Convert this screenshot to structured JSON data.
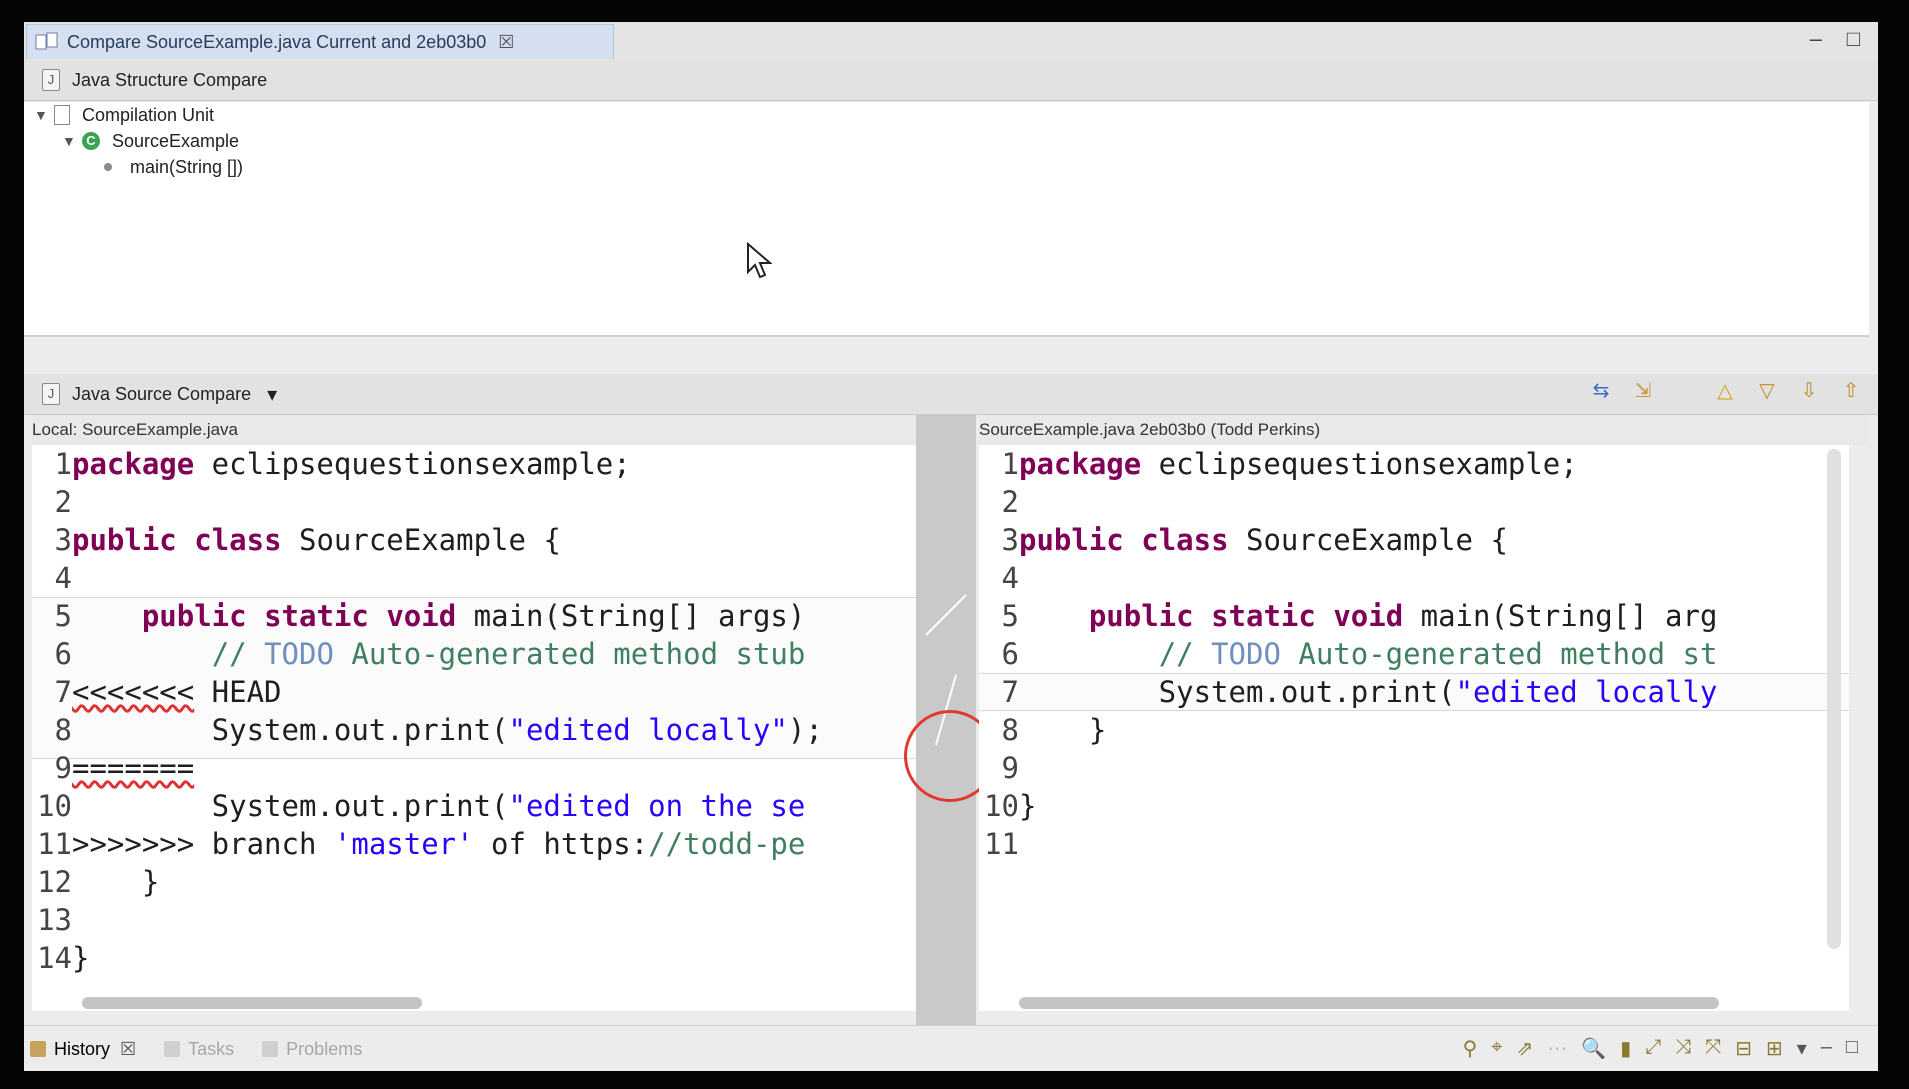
{
  "editor_tab": {
    "title": "Compare SourceExample.java Current and 2eb03b0",
    "close": "☒"
  },
  "window_controls": {
    "minimize": "–",
    "maximize": "□"
  },
  "structure_compare": {
    "title": "Java Structure Compare",
    "tree": [
      {
        "label": "Compilation Unit",
        "icon": "compilation-unit-icon"
      },
      {
        "label": "SourceExample",
        "icon": "class-icon"
      },
      {
        "label": "main(String [])",
        "icon": "method-icon"
      }
    ]
  },
  "source_compare": {
    "title": "Java Source Compare",
    "dropdown": "▾",
    "toolbar_icons": [
      "copy-all-icon",
      "copy-icon",
      "next-diff-icon",
      "prev-diff-icon",
      "next-change-icon",
      "prev-change-icon"
    ],
    "left_label": "Local: SourceExample.java",
    "right_label": "SourceExample.java 2eb03b0 (Todd Perkins)",
    "left_lines": [
      {
        "n": "1",
        "text": "package eclipsequestionsexample;"
      },
      {
        "n": "2",
        "text": ""
      },
      {
        "n": "3",
        "text": "public class SourceExample {"
      },
      {
        "n": "4",
        "text": ""
      },
      {
        "n": "5",
        "text": "    public static void main(String[] args)"
      },
      {
        "n": "6",
        "text": "        // TODO Auto-generated method stub"
      },
      {
        "n": "7",
        "text": "<<<<<<< HEAD"
      },
      {
        "n": "8",
        "text": "        System.out.print(\"edited locally\");"
      },
      {
        "n": "9",
        "text": "======="
      },
      {
        "n": "10",
        "text": "        System.out.print(\"edited on the se"
      },
      {
        "n": "11",
        "text": ">>>>>>> branch 'master' of https://todd-pe"
      },
      {
        "n": "12",
        "text": "    }"
      },
      {
        "n": "13",
        "text": ""
      },
      {
        "n": "14",
        "text": "}"
      }
    ],
    "right_lines": [
      {
        "n": "1",
        "text": "package eclipsequestionsexample;"
      },
      {
        "n": "2",
        "text": ""
      },
      {
        "n": "3",
        "text": "public class SourceExample {"
      },
      {
        "n": "4",
        "text": ""
      },
      {
        "n": "5",
        "text": "    public static void main(String[] arg"
      },
      {
        "n": "6",
        "text": "        // TODO Auto-generated method st"
      },
      {
        "n": "7",
        "text": "        System.out.print(\"edited locally"
      },
      {
        "n": "8",
        "text": "    }"
      },
      {
        "n": "9",
        "text": ""
      },
      {
        "n": "10",
        "text": "}"
      },
      {
        "n": "11",
        "text": ""
      }
    ]
  },
  "status_tabs": [
    {
      "label": "History",
      "close": "☒",
      "active": true
    },
    {
      "label": "Tasks",
      "active": false
    },
    {
      "label": "Problems",
      "active": false
    }
  ],
  "colors": {
    "keyword": "#7f0055",
    "comment": "#3f7f5f",
    "string": "#2a00ff",
    "annotation_circle": "#e03a2f"
  }
}
